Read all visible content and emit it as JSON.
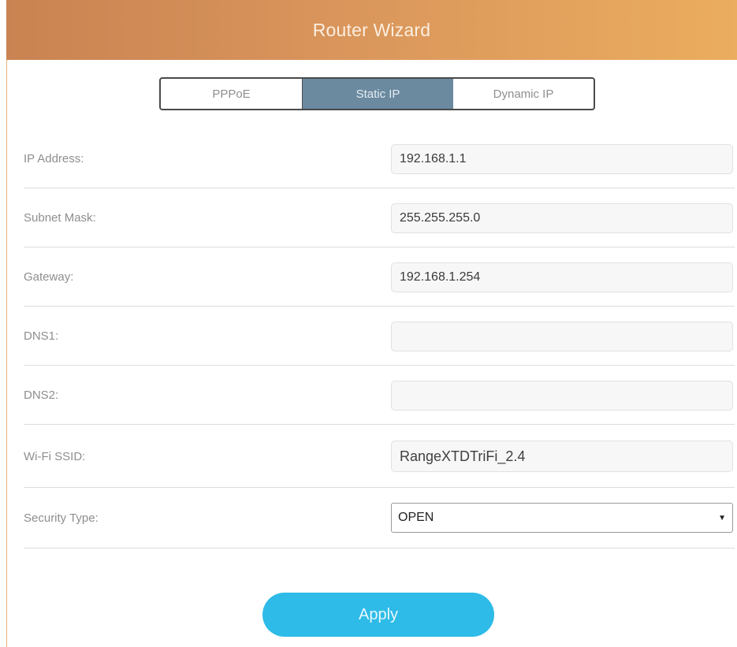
{
  "header": {
    "title": "Router Wizard"
  },
  "tabs": [
    {
      "label": "PPPoE",
      "active": false
    },
    {
      "label": "Static IP",
      "active": true
    },
    {
      "label": "Dynamic IP",
      "active": false
    }
  ],
  "form": {
    "ip_address": {
      "label": "IP Address:",
      "value": "192.168.1.1"
    },
    "subnet_mask": {
      "label": "Subnet Mask:",
      "value": "255.255.255.0"
    },
    "gateway": {
      "label": "Gateway:",
      "value": "192.168.1.254"
    },
    "dns1": {
      "label": "DNS1:",
      "value": ""
    },
    "dns2": {
      "label": "DNS2:",
      "value": ""
    },
    "wifi_ssid": {
      "label": "Wi-Fi SSID:",
      "value": "RangeXTDTriFi_2.4"
    },
    "security_type": {
      "label": "Security Type:",
      "value": "OPEN",
      "caret": "▼"
    }
  },
  "apply_label": "Apply",
  "colors": {
    "header_gradient_start": "#c98352",
    "header_gradient_end": "#ebad5f",
    "active_tab": "#6b8aa0",
    "apply_button": "#2ebbe8"
  }
}
